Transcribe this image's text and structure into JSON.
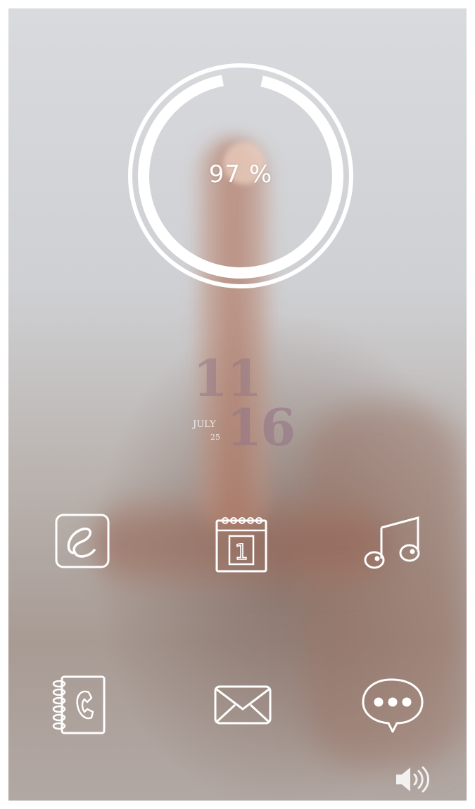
{
  "battery": {
    "percent_label": "97 %",
    "level": 0.97
  },
  "clock": {
    "hour": "11",
    "minute": "16",
    "month": "JULY",
    "day": "25"
  },
  "apps": [
    {
      "name": "browser",
      "icon": "browser-e-icon"
    },
    {
      "name": "calendar",
      "icon": "calendar-icon",
      "calendar_date": "1"
    },
    {
      "name": "music",
      "icon": "music-note-icon"
    },
    {
      "name": "contacts",
      "icon": "phonebook-icon"
    },
    {
      "name": "mail",
      "icon": "envelope-icon"
    },
    {
      "name": "messaging",
      "icon": "chat-bubble-icon"
    }
  ],
  "status": {
    "volume_icon": "speaker-volume-icon"
  },
  "colors": {
    "icon_stroke": "#ffffff",
    "clock_color": "#96788a"
  }
}
